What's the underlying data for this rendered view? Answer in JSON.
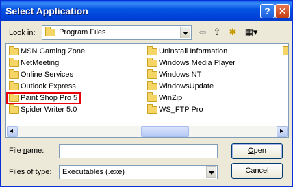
{
  "window": {
    "title": "Select Application",
    "help_glyph": "?",
    "close_glyph": "✕"
  },
  "lookin": {
    "label_u": "L",
    "label_rest": "ook in:",
    "value": "Program Files"
  },
  "toolbar": {
    "back_glyph": "⇦",
    "up_glyph": "⇧",
    "newfolder_glyph": "✱",
    "view_glyph": "▦▾"
  },
  "files": {
    "col1": [
      "MSN Gaming Zone",
      "NetMeeting",
      "Online Services",
      "Outlook Express",
      "Paint Shop Pro 5",
      "Spider Writer 5.0"
    ],
    "col2": [
      "Uninstall Information",
      "Windows Media Player",
      "Windows NT",
      "WindowsUpdate",
      "WinZip",
      "WS_FTP Pro"
    ],
    "highlighted": "Paint Shop Pro 5"
  },
  "scroll": {
    "left_glyph": "◂",
    "right_glyph": "▸"
  },
  "filename": {
    "label_pre": "File ",
    "label_u": "n",
    "label_post": "ame:",
    "value": ""
  },
  "filetype": {
    "label_pre": "Files of ",
    "label_u": "t",
    "label_post": "ype:",
    "value": "Executables (.exe)"
  },
  "buttons": {
    "open_u": "O",
    "open_rest": "pen",
    "cancel": "Cancel"
  },
  "colors": {
    "titlebar": "#0054e3",
    "highlight_box": "#e8000b",
    "dialog_bg": "#ece9d8"
  }
}
